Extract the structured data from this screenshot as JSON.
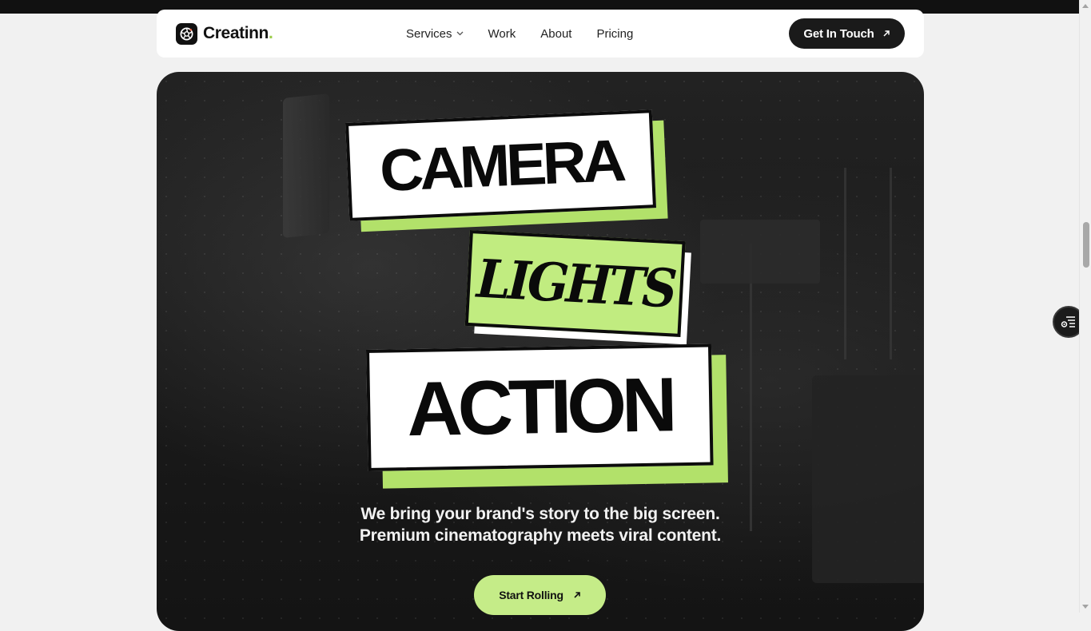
{
  "brand": {
    "name": "Creatinn",
    "dot": ".",
    "accent_color": "#b2e16a",
    "logo_icon": "aperture-icon"
  },
  "nav": {
    "items": [
      {
        "label": "Services",
        "has_dropdown": true
      },
      {
        "label": "Work"
      },
      {
        "label": "About"
      },
      {
        "label": "Pricing"
      }
    ],
    "cta_label": "Get In Touch",
    "cta_icon": "arrow-up-right-icon"
  },
  "hero": {
    "word1": "CAMERA",
    "word2": "LIGHTS",
    "word3": "ACTION",
    "subtitle_line1": "We bring your brand's story to the big screen.",
    "subtitle_line2": "Premium cinematography meets viral content.",
    "cta_label": "Start Rolling",
    "cta_icon": "arrow-up-right-icon"
  },
  "floating_widget": {
    "icon": "accessibility-menu-icon"
  }
}
